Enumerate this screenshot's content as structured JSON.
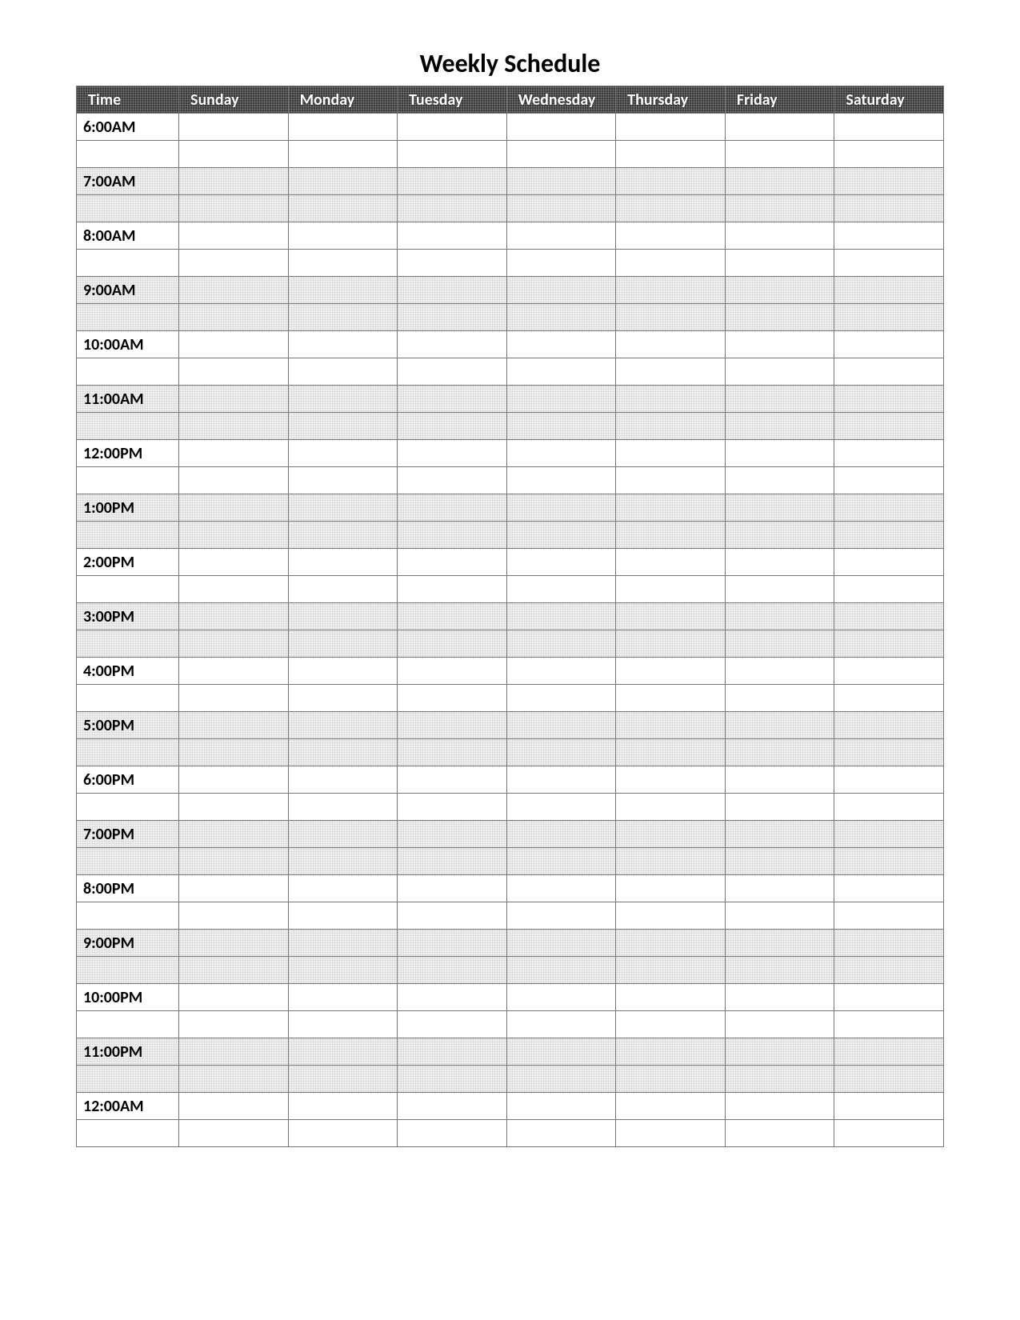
{
  "title": "Weekly Schedule",
  "columns": {
    "time": "Time",
    "sunday": "Sunday",
    "monday": "Monday",
    "tuesday": "Tuesday",
    "wednesday": "Wednesday",
    "thursday": "Thursday",
    "friday": "Friday",
    "saturday": "Saturday"
  },
  "time_slots": [
    "6:00AM",
    "7:00AM",
    "8:00AM",
    "9:00AM",
    "10:00AM",
    "11:00AM",
    "12:00PM",
    "1:00PM",
    "2:00PM",
    "3:00PM",
    "4:00PM",
    "5:00PM",
    "6:00PM",
    "7:00PM",
    "8:00PM",
    "9:00PM",
    "10:00PM",
    "11:00PM",
    "12:00AM"
  ]
}
